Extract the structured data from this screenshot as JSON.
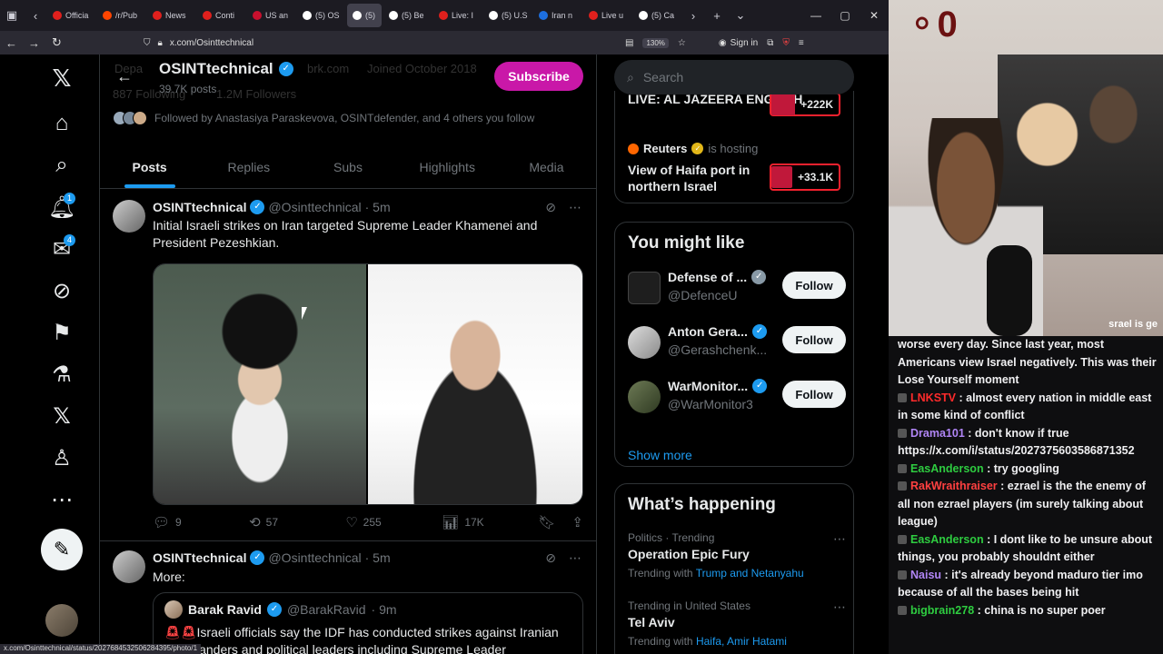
{
  "browser": {
    "tabs": [
      {
        "label": "Officia",
        "color": "#e0201d"
      },
      {
        "label": "/r/Pub",
        "color": "#ff4500"
      },
      {
        "label": "News",
        "color": "#e0201d"
      },
      {
        "label": "Conti",
        "color": "#e0201d"
      },
      {
        "label": "US an",
        "color": "#c8102e"
      },
      {
        "label": "(5) OS",
        "color": "#ffffff"
      },
      {
        "label": "(5)",
        "color": "#ffffff",
        "active": true
      },
      {
        "label": "(5) Be",
        "color": "#ffffff"
      },
      {
        "label": "Live: I",
        "color": "#e0201d"
      },
      {
        "label": "(5) U.S",
        "color": "#ffffff"
      },
      {
        "label": "Iran n",
        "color": "#1d6fe0"
      },
      {
        "label": "Live u",
        "color": "#e0201d"
      },
      {
        "label": "(5) Ca",
        "color": "#ffffff"
      }
    ],
    "url": "x.com/Osinttechnical",
    "zoom": "130%",
    "sign_in": "Sign in",
    "status_url": "x.com/Osinttechnical/status/2027684532506284395/photo/1"
  },
  "leftnav": {
    "notifications_badge": "1",
    "messages_badge": "4"
  },
  "profile": {
    "name": "OSINTtechnical",
    "posts": "39.7K posts",
    "subscribe": "Subscribe",
    "ghost_following": "887 Following",
    "ghost_followers": "1.2M Followers",
    "ghost_joined": "Joined October 2018",
    "ghost_link": "brk.com",
    "ghost_cat": "Depa",
    "followed_by": "Followed by Anastasiya Paraskevova, OSINTdefender, and 4 others you follow",
    "tabs": [
      "Posts",
      "Replies",
      "Subs",
      "Highlights",
      "Media"
    ]
  },
  "tweets": [
    {
      "name": "OSINTtechnical",
      "handle": "@Osinttechnical",
      "time": "· 5m",
      "text": "Initial Israeli strikes on Iran targeted Supreme Leader Khamenei and President Pezeshkian.",
      "replies": "9",
      "reposts": "57",
      "likes": "255",
      "views": "17K"
    },
    {
      "name": "OSINTtechnical",
      "handle": "@Osinttechnical",
      "time": "· 5m",
      "text": "More:",
      "quote": {
        "name": "Barak Ravid",
        "handle": "@BarakRavid",
        "time": "· 9m",
        "text": "Israeli officials say the IDF has conducted strikes against Iranian commanders and political leaders including Supreme Leader"
      }
    }
  ],
  "right": {
    "search_placeholder": "Search",
    "live1": {
      "title": "LIVE: AL JAZEERA ENGLISH",
      "count": "+222K"
    },
    "live2": {
      "host": "Reuters",
      "hosting": "is hosting",
      "title": "View of Haifa port in northern Israel",
      "count": "+33.1K"
    },
    "might_like_title": "You might like",
    "might_like": [
      {
        "name": "Defense of ...",
        "handle": "@DefenceU",
        "button": "Follow"
      },
      {
        "name": "Anton Gera...",
        "handle": "@Gerashchenk...",
        "button": "Follow"
      },
      {
        "name": "WarMonitor...",
        "handle": "@WarMonitor3",
        "button": "Follow"
      }
    ],
    "show_more": "Show more",
    "happening_title": "What’s happening",
    "trends": [
      {
        "cat": "Politics · Trending",
        "title": "Operation Epic Fury",
        "with": "Trending with",
        "tags": "Trump and Netanyahu"
      },
      {
        "cat": "Trending in United States",
        "title": "Tel Aviv",
        "with": "Trending with",
        "tags": "Haifa, Amir Hatami"
      }
    ]
  },
  "stream": {
    "overlay_partial": "srael is ge",
    "chat": [
      {
        "user": "",
        "user_color": "#efeff1",
        "text": "worse every day. Since last year, most Americans view Israel negatively. This was their Lose Yourself moment"
      },
      {
        "user": "LNKSTV",
        "user_color": "#ff2b2b",
        "text": ": almost every nation in middle east in some kind of conflict"
      },
      {
        "user": "Drama101",
        "user_color": "#b085f5",
        "text": ": don't know if true https://x.com/i/status/2027375603586871352"
      },
      {
        "user": "EasAnderson",
        "user_color": "#2ecc40",
        "text": ": try googling"
      },
      {
        "user": "RakWraithraiser",
        "user_color": "#ff4040",
        "text": ": ezrael is the the enemy of all non ezrael players (im surely talking about league)"
      },
      {
        "user": "EasAnderson",
        "user_color": "#2ecc40",
        "text": ": I dont like to be unsure about things, you probably shouldnt either"
      },
      {
        "user": "Naisu",
        "user_color": "#b085f5",
        "text": ": it's already beyond maduro tier imo because of all the bases being hit"
      },
      {
        "user": "bigbrain278",
        "user_color": "#2ecc40",
        "text": ": china is no super poer"
      }
    ]
  }
}
